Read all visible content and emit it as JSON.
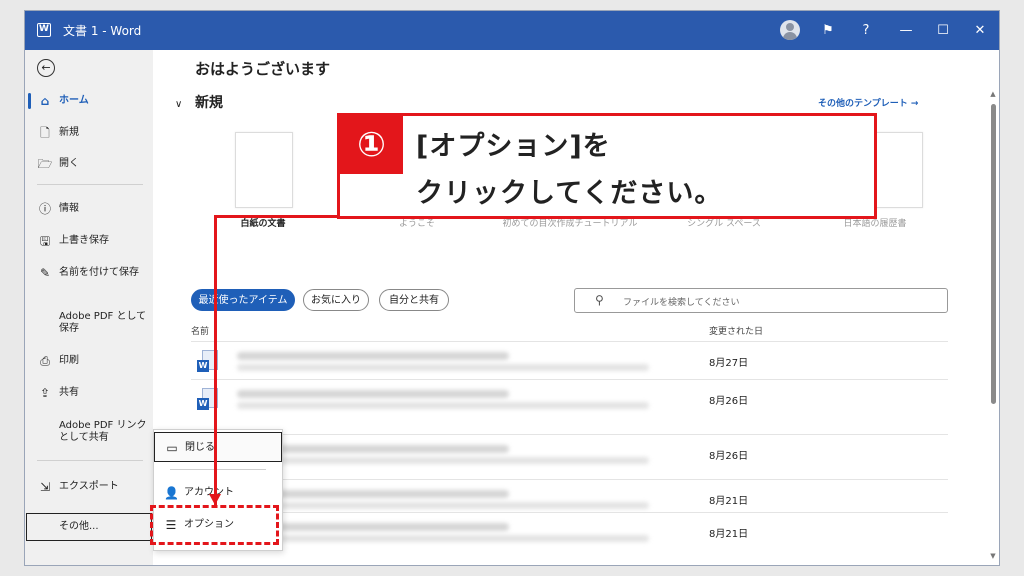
{
  "window": {
    "title": "文書 1 - Word",
    "app_icon": "W",
    "buttons": {
      "feedback": "⚑",
      "help": "?",
      "minimize": "—",
      "maximize": "☐",
      "close": "✕"
    }
  },
  "sidebar": {
    "back_icon": "←",
    "items": [
      {
        "label": "ホーム",
        "icon": "⌂",
        "active": true
      },
      {
        "label": "新規",
        "icon": "🗋"
      },
      {
        "label": "開く",
        "icon": "🗁"
      },
      {
        "label": "情報",
        "icon": "ⓘ"
      },
      {
        "label": "上書き保存",
        "icon": "🖫"
      },
      {
        "label": "名前を付けて保存",
        "icon": "✎"
      },
      {
        "label_line1": "Adobe PDF として",
        "label_line2": "保存"
      },
      {
        "label": "印刷",
        "icon": "⎙"
      },
      {
        "label": "共有",
        "icon": "⇪"
      },
      {
        "label_line1": "Adobe PDF リンク",
        "label_line2": "として共有"
      },
      {
        "label": "エクスポート",
        "icon": "⇲"
      }
    ],
    "more_label": "その他..."
  },
  "main": {
    "greeting": "おはようございます",
    "new_heading": "新規",
    "new_chevron": "∨",
    "more_templates": "その他のテンプレート →",
    "templates": [
      {
        "caption": "白紙の文書"
      },
      {
        "caption": "ようこそ"
      },
      {
        "caption": "初めての目次作成チュートリアル"
      },
      {
        "caption": "シングル スペース"
      },
      {
        "caption": "日本語の履歴書"
      }
    ],
    "filters": [
      "最近使ったアイテム",
      "お気に入り",
      "自分と共有"
    ],
    "search_placeholder": "ファイルを検索してください",
    "search_icon": "⚲",
    "col_name": "名前",
    "col_modified": "変更された日",
    "rows": [
      {
        "date": "8月27日"
      },
      {
        "date": "8月26日"
      },
      {
        "date": "8月26日"
      },
      {
        "date": "8月21日"
      },
      {
        "date": "8月21日"
      }
    ]
  },
  "popup": {
    "close_label": "閉じる",
    "close_icon": "▭",
    "account_label": "アカウント",
    "account_icon": "👤",
    "options_label": "オプション",
    "options_icon": "☰"
  },
  "annotation": {
    "number": "①",
    "line1": "[オプション]を",
    "line2": "クリックしてください。",
    "color": "#e3161b"
  },
  "colors": {
    "titlebar": "#2b5aad",
    "accent": "#1f5fb8"
  }
}
